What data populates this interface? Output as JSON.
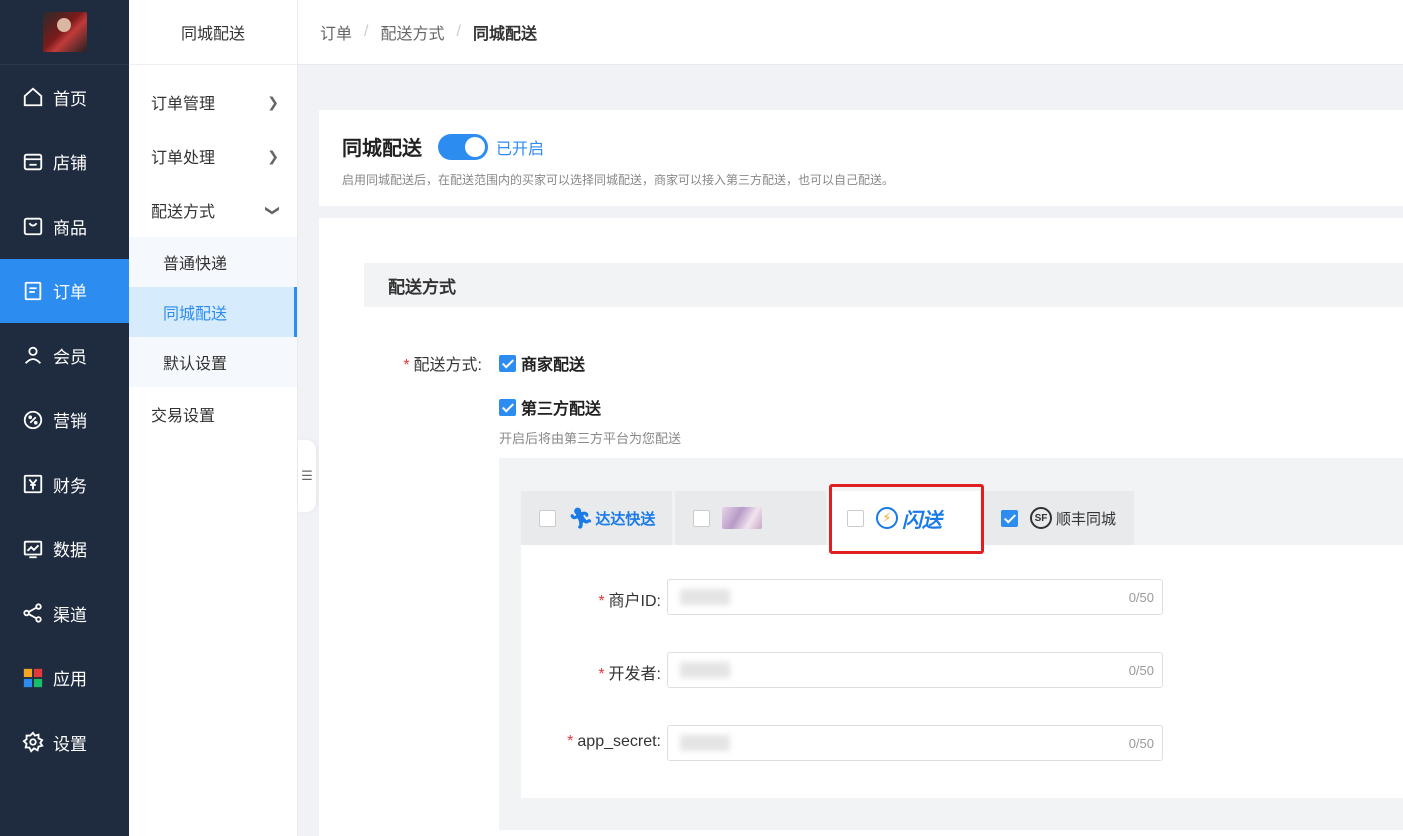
{
  "nav": {
    "items": [
      {
        "label": "首页",
        "icon": "home-icon"
      },
      {
        "label": "店铺",
        "icon": "store-icon"
      },
      {
        "label": "商品",
        "icon": "bag-icon"
      },
      {
        "label": "订单",
        "icon": "order-icon",
        "active": true
      },
      {
        "label": "会员",
        "icon": "user-icon"
      },
      {
        "label": "营销",
        "icon": "marketing-icon"
      },
      {
        "label": "财务",
        "icon": "finance-icon"
      },
      {
        "label": "数据",
        "icon": "chart-icon"
      },
      {
        "label": "渠道",
        "icon": "channel-icon"
      },
      {
        "label": "应用",
        "icon": "apps-icon"
      },
      {
        "label": "设置",
        "icon": "gear-icon"
      }
    ]
  },
  "sidebar": {
    "title": "同城配送",
    "menu": [
      {
        "label": "订单管理"
      },
      {
        "label": "订单处理"
      },
      {
        "label": "配送方式"
      }
    ],
    "submenu": [
      "普通快递",
      "同城配送",
      "默认设置"
    ],
    "trade": "交易设置"
  },
  "breadcrumb": [
    "订单",
    "配送方式",
    "同城配送"
  ],
  "header": {
    "title": "同城配送",
    "toggle_label": "已开启",
    "description": "启用同城配送后，在配送范围内的买家可以选择同城配送，商家可以接入第三方配送，也可以自己配送。"
  },
  "section": {
    "title": "配送方式"
  },
  "form": {
    "delivery_label": "配送方式:",
    "merchant_option": "商家配送",
    "third_party_option": "第三方配送",
    "third_party_hint": "开启后将由第三方平台为您配送",
    "providers": [
      {
        "name": "达达快送",
        "checked": false
      },
      {
        "name": "",
        "checked": false
      },
      {
        "name": "闪送",
        "checked": false
      },
      {
        "name": "顺丰同城",
        "checked": true
      }
    ],
    "fields": [
      {
        "label": "商户ID:",
        "count": "0/50"
      },
      {
        "label": "开发者:",
        "count": "0/50"
      },
      {
        "label": "app_secret:",
        "count": "0/50"
      }
    ]
  },
  "colors": {
    "accent": "#2d8cf0",
    "nav_bg": "#1f2b3e",
    "required": "#e4393c",
    "highlight": "#e02020"
  }
}
